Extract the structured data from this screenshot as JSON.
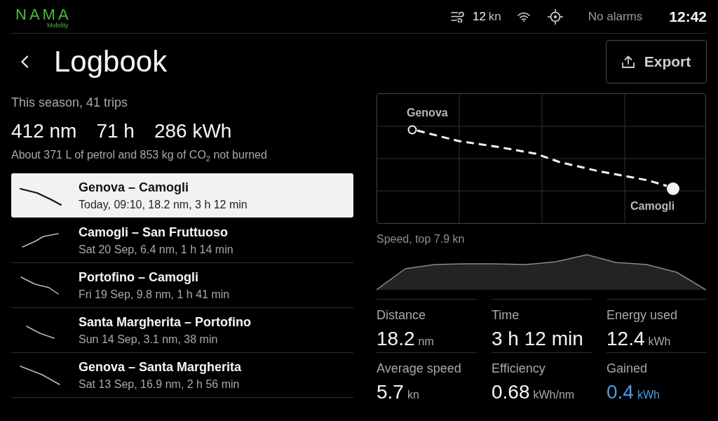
{
  "top_bar": {
    "logo": {
      "wordmark": "NAMA",
      "tagline": "Mobility"
    },
    "wind": {
      "value": "12",
      "unit": "kn"
    },
    "alarms": "No alarms",
    "clock": "12:42"
  },
  "header": {
    "title": "Logbook",
    "export_button": "Export"
  },
  "season": {
    "caption": "This season, 41 trips",
    "totals": [
      "412 nm",
      "71 h",
      "286 kWh"
    ],
    "savings": "About 371 L of petrol and 853 kg of CO$_{2}$ not burned"
  },
  "trips": [
    {
      "route": "Genova – Camogli",
      "details": "Today, 09:10, 18.2 nm, 3 h 12 min",
      "selected": true
    },
    {
      "route": "Camogli – San Fruttuoso",
      "details": "Sat 20 Sep, 6.4 nm, 1 h 14 min",
      "selected": false
    },
    {
      "route": "Portofino – Camogli",
      "details": "Fri 19 Sep, 9.8 nm, 1 h 41 min",
      "selected": false
    },
    {
      "route": "Santa Margherita – Portofino",
      "details": "Sun 14 Sep, 3.1 nm, 38 min",
      "selected": false
    },
    {
      "route": "Genova – Santa Margherita",
      "details": "Sat 13 Sep, 16.9 nm, 2 h 56 min",
      "selected": false
    }
  ],
  "map": {
    "start_label": "Genova",
    "end_label": "Camogli"
  },
  "speed_profile": {
    "caption": "Speed, top 7.9 kn"
  },
  "metrics": [
    {
      "label": "Distance",
      "value": "18.2",
      "unit": "nm",
      "accent": false
    },
    {
      "label": "Time",
      "value": "3 h 12 min",
      "accent": false
    },
    {
      "label": "Energy used",
      "value": "12.4",
      "unit": "kWh",
      "accent": false
    },
    {
      "label": "Average speed",
      "value": "5.7",
      "unit": "kn",
      "accent": false
    },
    {
      "label": "Efficiency",
      "value": "0.68",
      "unit": "kWh/nm",
      "accent": false
    },
    {
      "label": "Gained",
      "value": "0.4",
      "unit": "kWh",
      "accent": true
    }
  ]
}
